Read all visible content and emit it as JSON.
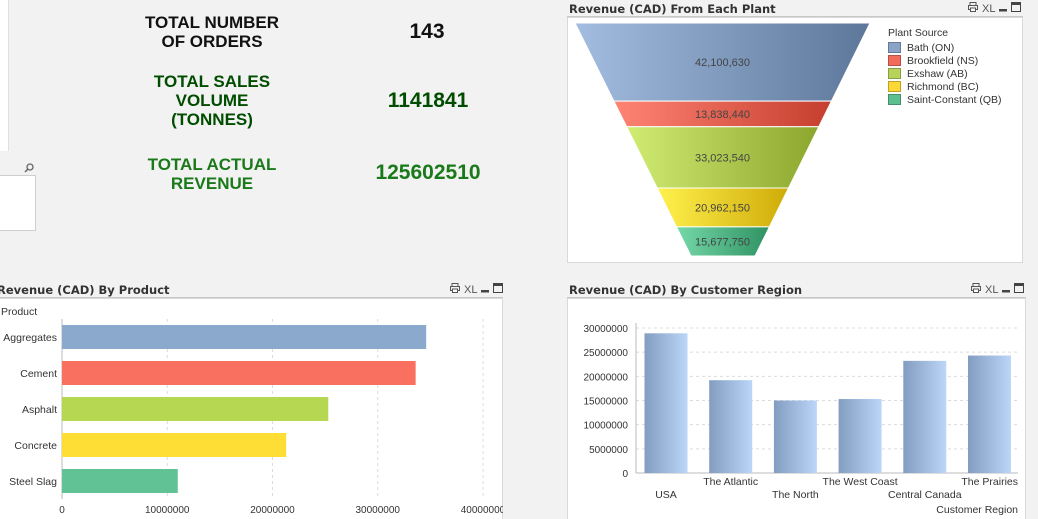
{
  "kpis": [
    {
      "label_lines": [
        "TOTAL NUMBER",
        "OF ORDERS"
      ],
      "value": "143",
      "color": "#111111"
    },
    {
      "label_lines": [
        "TOTAL SALES",
        "VOLUME",
        "(TONNES)"
      ],
      "value": "1141841",
      "color": "#004d00"
    },
    {
      "label_lines": [
        "TOTAL ACTUAL",
        "REVENUE"
      ],
      "value": "125602510",
      "color": "#1a7a1a"
    }
  ],
  "search_icon": "search-icon",
  "panels": {
    "plant": {
      "title": "Revenue (CAD) From Each Plant"
    },
    "product": {
      "title": "Revenue (CAD) By Product"
    },
    "region": {
      "title": "Revenue (CAD) By Customer Region"
    }
  },
  "tools": {
    "print_icon": "printer-icon",
    "xl": "XL",
    "minimize_icon": "minimize-icon",
    "maximize_icon": "maximize-icon"
  },
  "chart_data": [
    {
      "type": "funnel",
      "title": "Revenue (CAD) From Each Plant",
      "legend_title": "Plant Source",
      "legend_placement": "right",
      "categories": [
        "Bath (ON)",
        "Brookfield (NS)",
        "Exshaw (AB)",
        "Richmond (BC)",
        "Saint-Constant (QB)"
      ],
      "values": [
        42100630,
        13838440,
        33023540,
        20962150,
        15677750
      ],
      "value_labels": [
        "42,100,630",
        "13,838,440",
        "33,023,540",
        "20,962,150",
        "15,677,750"
      ],
      "colors": [
        "#8aa4c8",
        "#f26b5b",
        "#b8d35a",
        "#fcd835",
        "#5cbf8f"
      ]
    },
    {
      "type": "bar",
      "orientation": "horizontal",
      "title": "Revenue (CAD) By Product",
      "ylabel": "Product",
      "categories": [
        "Aggregates",
        "Cement",
        "Asphalt",
        "Concrete",
        "Steel Slag"
      ],
      "values": [
        34600000,
        33600000,
        25300000,
        21300000,
        11000000
      ],
      "colors": [
        "#8aa9cc",
        "#fa7060",
        "#b6d751",
        "#fedd35",
        "#61c295"
      ],
      "xlim": [
        0,
        40000000
      ],
      "x_ticks": [
        "0",
        "10000000",
        "20000000",
        "30000000",
        "40000000"
      ],
      "grid": true
    },
    {
      "type": "bar",
      "title": "Revenue (CAD) By Customer Region",
      "xlabel": "Customer Region",
      "categories": [
        "USA",
        "The Atlantic",
        "The North",
        "The West Coast",
        "Central Canada",
        "The Prairies"
      ],
      "values": [
        28900000,
        19200000,
        15000000,
        15300000,
        23200000,
        24300000
      ],
      "ylim": [
        0,
        30000000
      ],
      "y_ticks": [
        "0",
        "5000000",
        "10000000",
        "15000000",
        "20000000",
        "25000000",
        "30000000"
      ],
      "colors": [
        "#8fa9cd"
      ],
      "grid": true
    }
  ]
}
